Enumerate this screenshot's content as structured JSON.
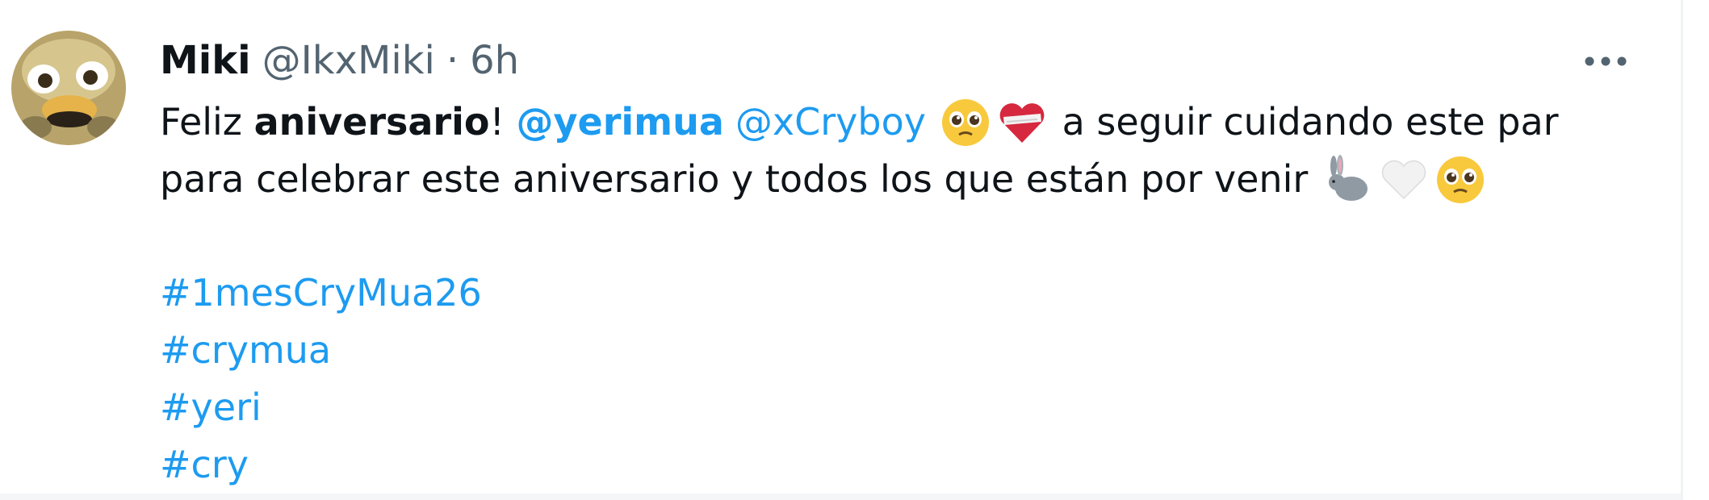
{
  "tweet": {
    "author": {
      "name": "Miki",
      "handle": "@IkxMiki",
      "separator": "·",
      "time": "6h"
    },
    "more_icon": "more-horizontal-icon",
    "text": {
      "line1": {
        "t1": "Feliz ",
        "t2": "aniversario",
        "t3": "! ",
        "mention1": "@yerimua",
        "mention2": "@xCryboy",
        "t4": " a seguir cuidando este par"
      },
      "line2": {
        "t1": "para celebrar este aniversario y todos los que están por venir"
      },
      "hashtags": [
        "#1mesCryMua26",
        "#crymua",
        "#yeri",
        "#cry"
      ]
    },
    "emojis": {
      "line1": [
        "pleading-face",
        "mending-heart"
      ],
      "line2": [
        "rabbit",
        "white-heart",
        "pleading-face"
      ]
    },
    "colors": {
      "link": "#1d9bf0",
      "secondary_text": "#536471",
      "primary_text": "#0f1419"
    }
  }
}
